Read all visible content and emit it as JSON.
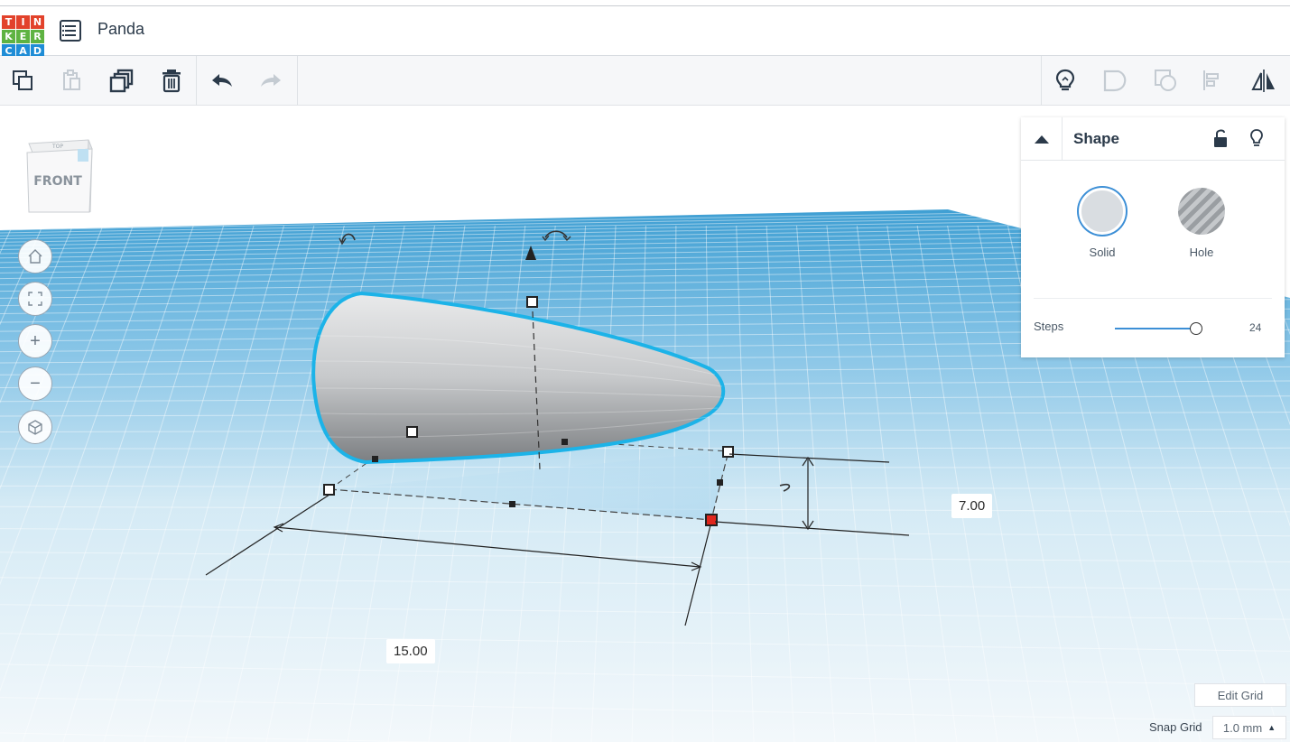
{
  "app": {
    "logo_letters": [
      "T",
      "I",
      "N",
      "K",
      "E",
      "R",
      "C",
      "A",
      "D"
    ],
    "project_title": "Panda"
  },
  "toolbar": {
    "left_icons": [
      "copy-icon",
      "paste-icon",
      "duplicate-icon",
      "delete-icon",
      "undo-icon",
      "redo-icon"
    ],
    "right_icons": [
      "notes-lightbulb-icon",
      "group-icon",
      "ungroup-icon",
      "align-icon",
      "mirror-icon"
    ]
  },
  "viewcube": {
    "face_label": "FRONT",
    "top_label": "TOP"
  },
  "nav": {
    "icons": [
      "home-icon",
      "fit-view-icon",
      "zoom-in-icon",
      "zoom-out-icon",
      "perspective-icon"
    ],
    "zoom_in_glyph": "+",
    "zoom_out_glyph": "−"
  },
  "dimensions": {
    "height_value": "7.00",
    "length_value": "15.00"
  },
  "inspector": {
    "title": "Shape",
    "solid_label": "Solid",
    "hole_label": "Hole",
    "steps_label": "Steps",
    "steps_value": "24",
    "steps_fraction": 0.92
  },
  "grid": {
    "edit_grid_label": "Edit Grid",
    "snap_grid_label": "Snap Grid",
    "snap_grid_value": "1.0 mm",
    "snap_caret": "▲"
  },
  "colors": {
    "grid_blue": "#49a7d8",
    "selection_outline": "#1cb3e8",
    "solid_swatch": "#d9dde1",
    "accent": "#3c8fd6"
  }
}
